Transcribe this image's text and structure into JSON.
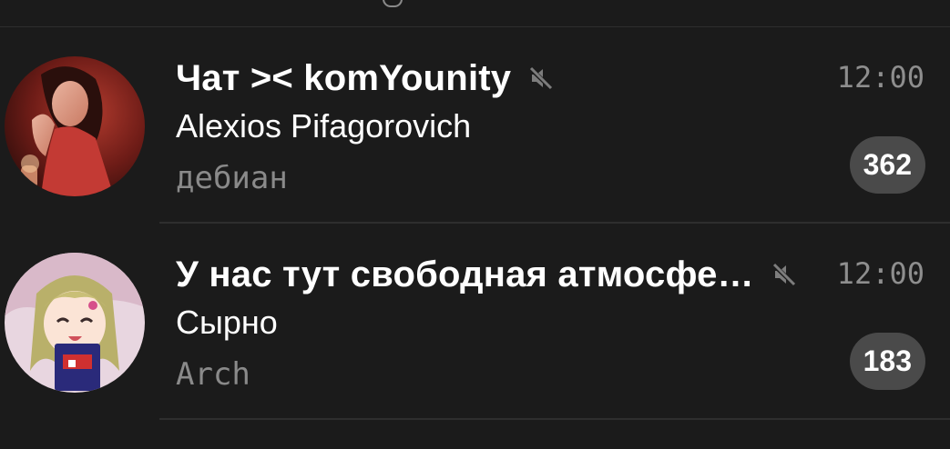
{
  "chats": [
    {
      "title": "Чат >< komYounity",
      "time": "12:00",
      "sender": "Alexios Pifagorovich",
      "preview": "дебиан",
      "unread": "362",
      "muted": true
    },
    {
      "title": "У нас тут свободная атмосфе…",
      "time": "12:00",
      "sender": "Сырно",
      "preview": "Arch",
      "unread": "183",
      "muted": true
    }
  ],
  "icons": {
    "mute": "muted-speaker-icon"
  },
  "colors": {
    "background": "#1b1b1b",
    "badge": "#4a4a4a",
    "secondary_text": "#8a8a8a",
    "primary_text": "#ffffff",
    "separator": "#2e2e2e"
  }
}
